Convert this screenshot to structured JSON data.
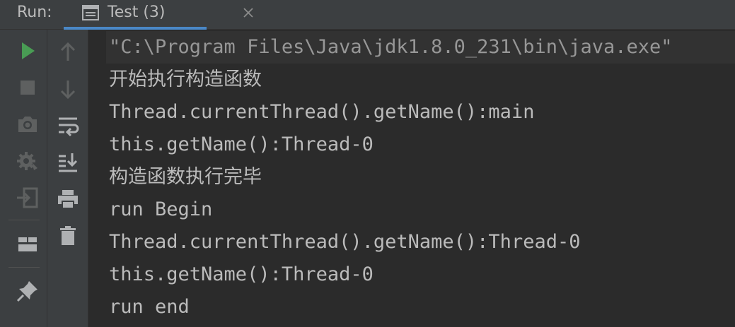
{
  "header": {
    "run_label": "Run:",
    "tab": {
      "label": "Test (3)",
      "icon": "console-icon",
      "close_icon": "close-icon"
    }
  },
  "toolbar_primary": {
    "items": [
      {
        "name": "rerun-icon",
        "color": "#499C54"
      },
      {
        "name": "stop-icon",
        "color": "#5E6060"
      },
      {
        "name": "camera-icon",
        "color": "#5E6060"
      },
      {
        "name": "settings-gear-icon",
        "color": "#5E6060"
      },
      {
        "name": "exit-icon",
        "color": "#5E6060"
      },
      {
        "name": "layout-icon",
        "color": "#AFB1B3"
      },
      {
        "name": "pin-icon",
        "color": "#AFB1B3"
      }
    ]
  },
  "toolbar_secondary": {
    "items": [
      {
        "name": "arrow-up-icon",
        "color": "#5E6060"
      },
      {
        "name": "arrow-down-icon",
        "color": "#5E6060"
      },
      {
        "name": "soft-wrap-icon",
        "color": "#AFB1B3"
      },
      {
        "name": "scroll-to-end-icon",
        "color": "#AFB1B3"
      },
      {
        "name": "print-icon",
        "color": "#AFB1B3"
      },
      {
        "name": "trash-icon",
        "color": "#AFB1B3"
      }
    ]
  },
  "console": {
    "lines": [
      "\"C:\\Program Files\\Java\\jdk1.8.0_231\\bin\\java.exe\"",
      "开始执行构造函数",
      "Thread.currentThread().getName():main",
      "this.getName():Thread-0",
      "构造函数执行完毕",
      "run Begin",
      "Thread.currentThread().getName():Thread-0",
      "this.getName():Thread-0",
      "run end"
    ]
  },
  "colors": {
    "background": "#2B2B2B",
    "panel": "#3C3F41",
    "text": "#BBBBBB",
    "accent": "#4A88C7",
    "run_green": "#499C54"
  }
}
